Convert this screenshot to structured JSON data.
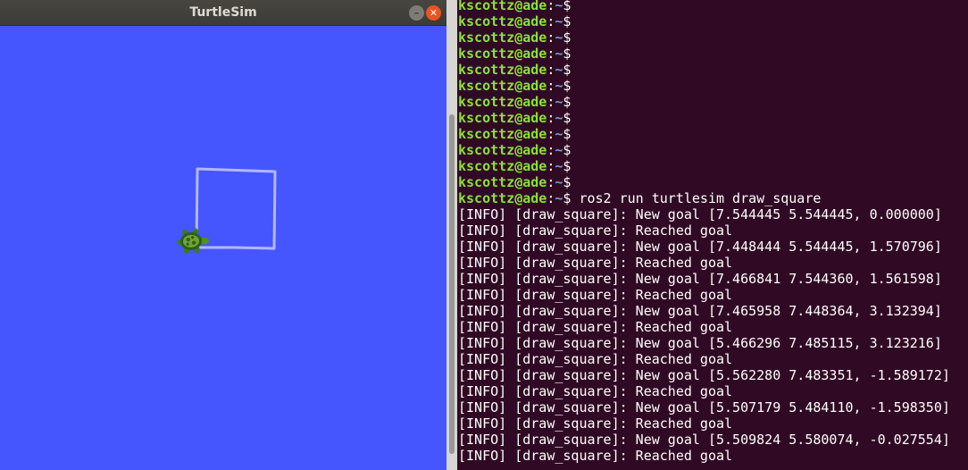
{
  "turtlesim": {
    "title": "TurtleSim",
    "minimize_glyph": "–",
    "close_glyph": "✕",
    "background_color": "#4556ff",
    "pen_color": "#b3b8ff",
    "turtle_icon": "turtle-icon"
  },
  "terminal": {
    "prompt": {
      "user_host": "kscottz@ade",
      "separator": ":",
      "path": "~",
      "dollar": "$"
    },
    "empty_prompt_count": 12,
    "command": " ros2 run turtlesim draw_square",
    "log_lines": [
      "[INFO] [draw_square]: New goal [7.544445 5.544445, 0.000000]",
      "[INFO] [draw_square]: Reached goal",
      "[INFO] [draw_square]: New goal [7.448444 5.544445, 1.570796]",
      "[INFO] [draw_square]: Reached goal",
      "[INFO] [draw_square]: New goal [7.466841 7.544360, 1.561598]",
      "[INFO] [draw_square]: Reached goal",
      "[INFO] [draw_square]: New goal [7.465958 7.448364, 3.132394]",
      "[INFO] [draw_square]: Reached goal",
      "[INFO] [draw_square]: New goal [5.466296 7.485115, 3.123216]",
      "[INFO] [draw_square]: Reached goal",
      "[INFO] [draw_square]: New goal [5.562280 7.483351, -1.589172]",
      "[INFO] [draw_square]: Reached goal",
      "[INFO] [draw_square]: New goal [5.507179 5.484110, -1.598350]",
      "[INFO] [draw_square]: Reached goal",
      "[INFO] [draw_square]: New goal [5.509824 5.580074, -0.027554]",
      "[INFO] [draw_square]: Reached goal"
    ],
    "colors": {
      "background": "#300a24",
      "user_host": "#8ae234",
      "path": "#729fcf",
      "text": "#ffffff"
    }
  }
}
